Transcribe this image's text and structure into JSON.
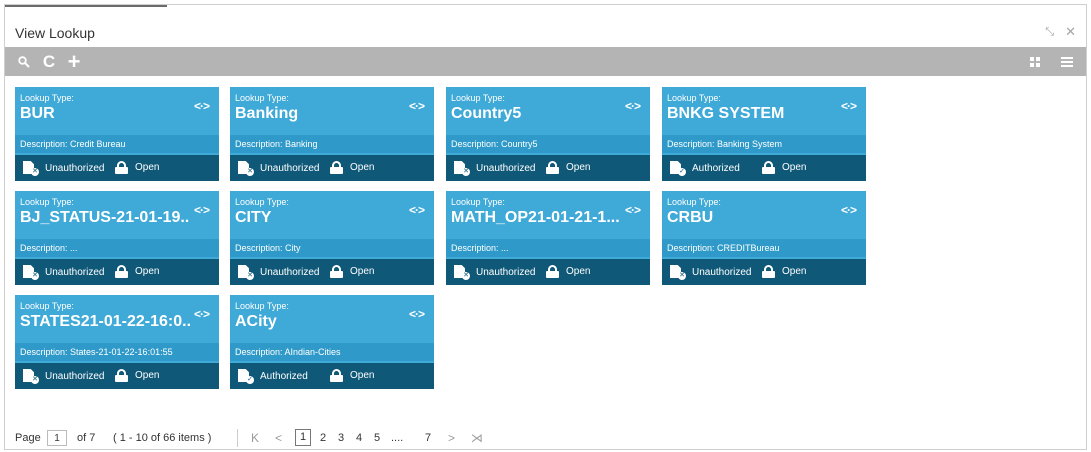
{
  "window": {
    "title": "View Lookup",
    "minimize_glyph": "⤡",
    "close_glyph": "✕"
  },
  "toolbar": {
    "search_icon": "search-icon",
    "refresh_glyph": "C",
    "add_glyph": "+"
  },
  "card_labels": {
    "lookup_type": "Lookup Type:",
    "link_glyph": "<·>"
  },
  "cards": [
    {
      "type": "BUR",
      "description": "Description: Credit Bureau",
      "status": "Unauthorized",
      "state": "Open"
    },
    {
      "type": "Banking",
      "description": "Description: Banking",
      "status": "Unauthorized",
      "state": "Open"
    },
    {
      "type": "Country5",
      "description": "Description: Country5",
      "status": "Unauthorized",
      "state": "Open"
    },
    {
      "type": "BNKG SYSTEM",
      "description": "Description: Banking System",
      "status": "Authorized",
      "state": "Open"
    },
    {
      "type": "BJ_STATUS-21-01-19...",
      "description": "Description: ...",
      "status": "Unauthorized",
      "state": "Open"
    },
    {
      "type": "CITY",
      "description": "Description: City",
      "status": "Unauthorized",
      "state": "Open"
    },
    {
      "type": "MATH_OP21-01-21-1...",
      "description": "Description: ...",
      "status": "Unauthorized",
      "state": "Open"
    },
    {
      "type": "CRBU",
      "description": "Description: CREDITBureau",
      "status": "Unauthorized",
      "state": "Open"
    },
    {
      "type": "STATES21-01-22-16:0...",
      "description": "Description: States-21-01-22-16:01:55",
      "status": "Unauthorized",
      "state": "Open"
    },
    {
      "type": "ACity",
      "description": "Description: AIndian-Cities",
      "status": "Authorized",
      "state": "Open"
    }
  ],
  "pager": {
    "page_label": "Page",
    "page_value": "1",
    "of_pages": "of 7",
    "items_info": "( 1 - 10 of 66 items )",
    "first_glyph": "K",
    "prev_glyph": "<",
    "pages": [
      "1",
      "2",
      "3",
      "4",
      "5",
      "....",
      "7"
    ],
    "next_glyph": ">",
    "last_glyph": "⋊"
  }
}
